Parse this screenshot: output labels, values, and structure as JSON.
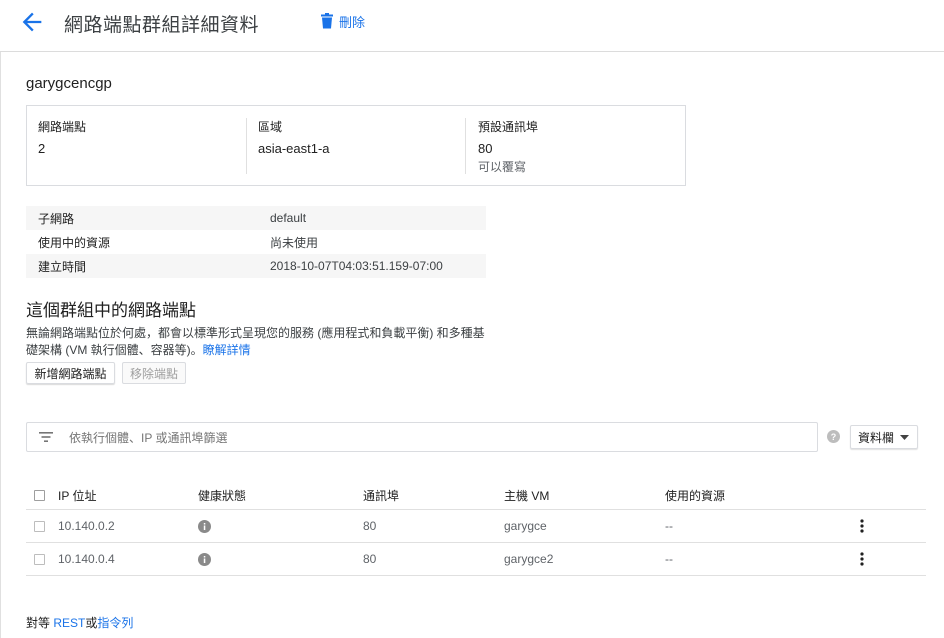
{
  "header": {
    "title": "網路端點群組詳細資料",
    "delete_label": "刪除",
    "accent_color": "#1a73e8"
  },
  "neg_name": "garygcencgp",
  "summary": {
    "endpoints": {
      "label": "網路端點",
      "value": "2"
    },
    "zone": {
      "label": "區域",
      "value": "asia-east1-a"
    },
    "default_port": {
      "label": "預設通訊埠",
      "value": "80",
      "note": "可以覆寫"
    }
  },
  "properties": [
    {
      "key": "子網路",
      "value": "default"
    },
    {
      "key": "使用中的資源",
      "value": "尚未使用"
    },
    {
      "key": "建立時間",
      "value": "2018-10-07T04:03:51.159-07:00"
    }
  ],
  "section": {
    "title": "這個群組中的網路端點",
    "description": "無論網路端點位於何處，都會以標準形式呈現您的服務 (應用程式和負載平衡) 和多種基礎架構 (VM 執行個體、容器等)。",
    "learn_more": "瞭解詳情"
  },
  "buttons": {
    "add": "新增網路端點",
    "remove": "移除端點"
  },
  "filter": {
    "placeholder": "依執行個體、IP 或通訊埠篩選",
    "value": ""
  },
  "columns_button": "資料欄",
  "table": {
    "headers": [
      "IP 位址",
      "健康狀態",
      "通訊埠",
      "主機 VM",
      "使用的資源"
    ],
    "rows": [
      {
        "ip": "10.140.0.2",
        "port": "80",
        "vm": "garygce",
        "resources": "--"
      },
      {
        "ip": "10.140.0.4",
        "port": "80",
        "vm": "garygce2",
        "resources": "--"
      }
    ]
  },
  "footer": {
    "prefix": "對等",
    "rest": "REST",
    "or": "或",
    "cli": "指令列"
  },
  "icons": {
    "back": "arrow-back-icon",
    "delete": "trash-icon",
    "filter": "filter-icon",
    "help": "help-icon",
    "dropdown": "caret-down-icon",
    "health": "info-icon",
    "more": "more-vert-icon"
  }
}
